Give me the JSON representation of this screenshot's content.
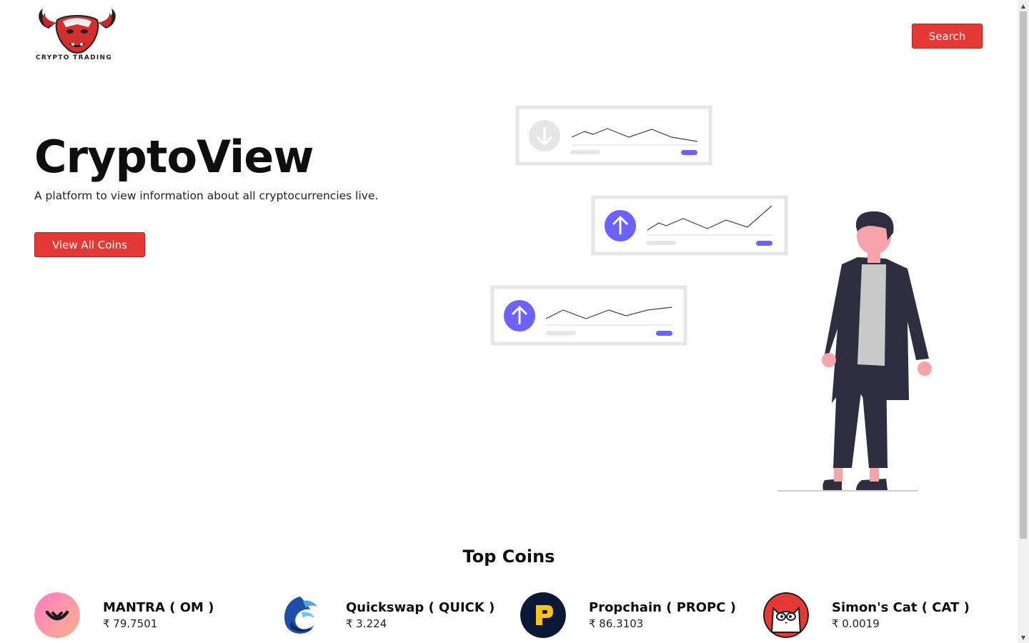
{
  "header": {
    "logo_text": "CRYPTO TRADING",
    "search_label": "Search"
  },
  "hero": {
    "title": "CryptoView",
    "subtitle": "A platform to view information about all cryptocurrencies live.",
    "cta_label": "View All Coins",
    "illustration": "analytics-person-illustration"
  },
  "top_coins": {
    "title": "Top Coins",
    "items": [
      {
        "name": "MANTRA ( OM )",
        "price": "₹ 79.7501",
        "icon": "mantra-logo"
      },
      {
        "name": "Quickswap ( QUICK )",
        "price": "₹ 3.224",
        "icon": "quickswap-logo"
      },
      {
        "name": "Propchain ( PROPC )",
        "price": "₹ 86.3103",
        "icon": "propchain-logo"
      },
      {
        "name": "Simon's Cat ( CAT )",
        "price": "₹ 0.0019",
        "icon": "simons-cat-logo"
      }
    ]
  },
  "colors": {
    "accent": "#e53935",
    "illustration_purple": "#6c63ff",
    "figure_dark": "#2f2e41"
  }
}
